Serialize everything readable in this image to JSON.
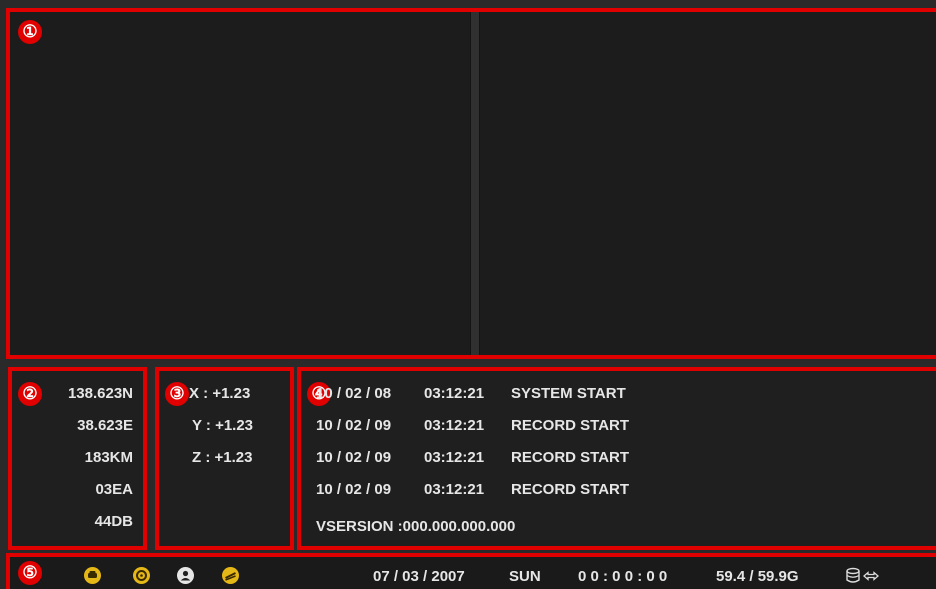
{
  "zones": {
    "camera": "①",
    "gps": "②",
    "gsensor": "③",
    "log": "④",
    "status": "⑤"
  },
  "gps": {
    "latitude": "138.623N",
    "longitude": "38.623E",
    "speed": "183KM",
    "satellites": "03EA",
    "signal": "44DB"
  },
  "gsensor": {
    "x": "X : +1.23",
    "y": "Y : +1.23",
    "z": "Z : +1.23"
  },
  "log": {
    "entries": [
      {
        "date": "10 / 02 / 08",
        "time": "03:12:21",
        "event": "SYSTEM START"
      },
      {
        "date": "10 / 02 / 09",
        "time": "03:12:21",
        "event": "RECORD START"
      },
      {
        "date": "10 / 02 / 09",
        "time": "03:12:21",
        "event": "RECORD START"
      },
      {
        "date": "10 / 02 / 09",
        "time": "03:12:21",
        "event": "RECORD START"
      }
    ],
    "version": "VSERSION :000.000.000.000"
  },
  "status": {
    "icons": [
      "car-icon",
      "wheel-icon",
      "user-icon",
      "speed-icon"
    ],
    "date": "07 / 03 / 2007",
    "day": "SUN",
    "time": "0 0 : 0 0 : 0 0",
    "storage": "59.4 / 59.9G",
    "accent": "#e6b817",
    "border": "#e00000"
  }
}
